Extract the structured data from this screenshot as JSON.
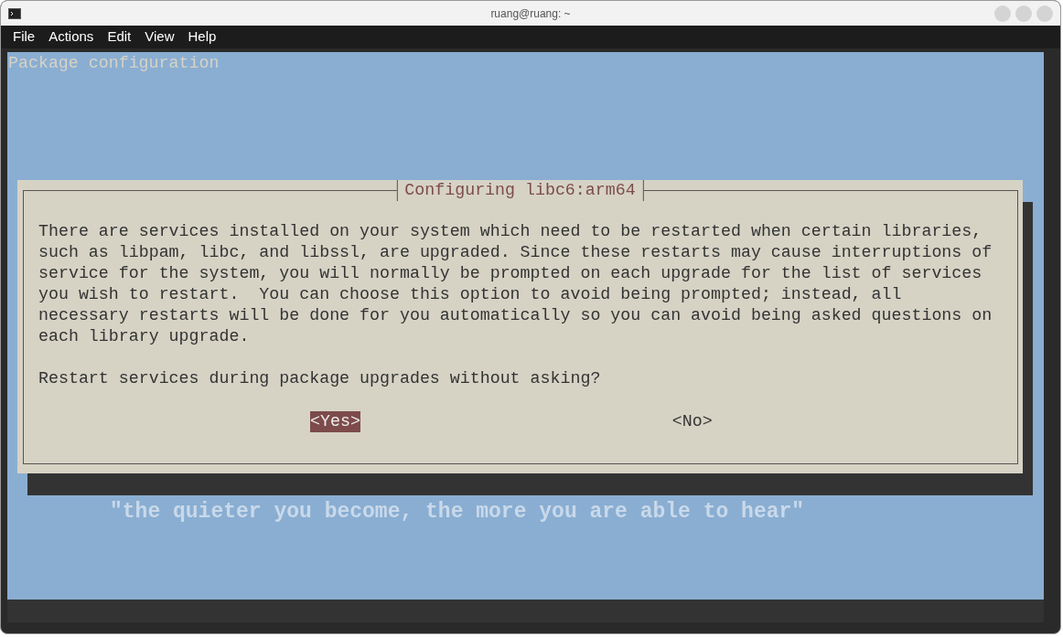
{
  "window": {
    "title": "ruang@ruang: ~"
  },
  "menu": [
    "File",
    "Actions",
    "Edit",
    "View",
    "Help"
  ],
  "terminal": {
    "header": "Package configuration",
    "dialog": {
      "title": "Configuring libc6:arm64",
      "message": "There are services installed on your system which need to be restarted when certain libraries,\nsuch as libpam, libc, and libssl, are upgraded. Since these restarts may cause interruptions of\nservice for the system, you will normally be prompted on each upgrade for the list of services\nyou wish to restart.  You can choose this option to avoid being prompted; instead, all\nnecessary restarts will be done for you automatically so you can avoid being asked questions on\neach library upgrade.",
      "question": "Restart services during package upgrades without asking?",
      "buttons": [
        {
          "label": "<Yes>",
          "selected": true
        },
        {
          "label": "<No>",
          "selected": false
        }
      ]
    },
    "wallpaper_quote": "\"the quieter you become, the more you are able to hear\""
  }
}
